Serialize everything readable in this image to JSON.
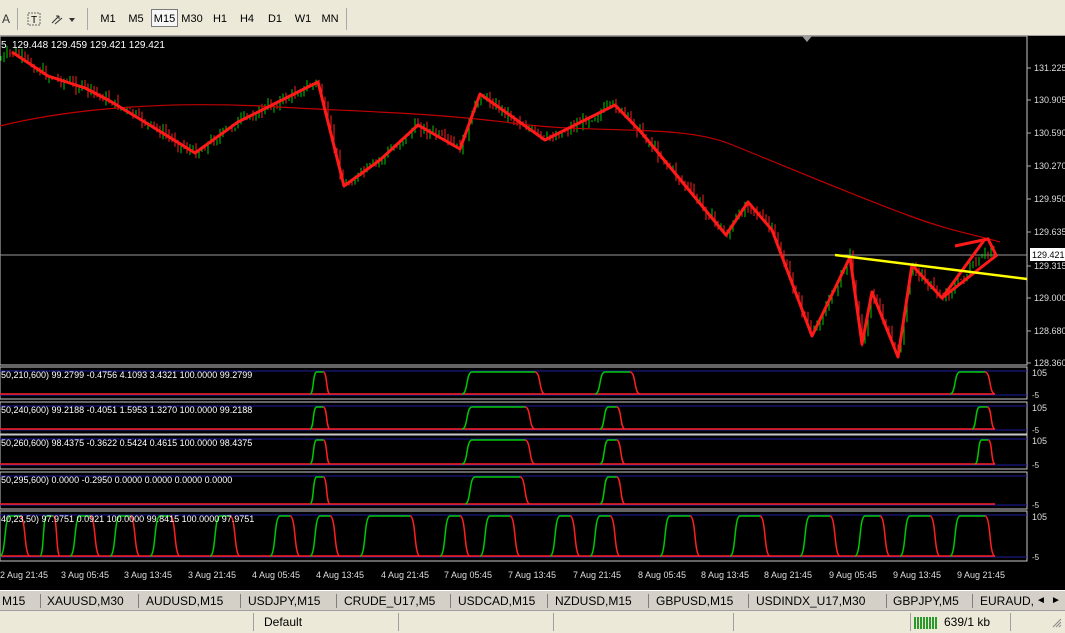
{
  "toolbar": {
    "left_label": "A",
    "timeframes": [
      "M1",
      "M5",
      "M15",
      "M30",
      "H1",
      "H4",
      "D1",
      "W1",
      "MN"
    ],
    "selected_timeframe": "M15"
  },
  "chart": {
    "ohlc_header": {
      "prefix": "5",
      "values": "129.448 129.459 129.421 129.421"
    },
    "price_labels": [
      "131.225",
      "130.905",
      "130.590",
      "130.270",
      "129.950",
      "129.635",
      "129.315",
      "129.000",
      "128.680",
      "128.360"
    ],
    "current_price": "129.421",
    "time_labels": [
      "2 Aug 21:45",
      "3 Aug 05:45",
      "3 Aug 13:45",
      "3 Aug 21:45",
      "4 Aug 05:45",
      "4 Aug 13:45",
      "4 Aug 21:45",
      "7 Aug 05:45",
      "7 Aug 13:45",
      "7 Aug 21:45",
      "8 Aug 05:45",
      "8 Aug 13:45",
      "8 Aug 21:45",
      "9 Aug 05:45",
      "9 Aug 13:45",
      "9 Aug 21:45"
    ],
    "indicators": [
      {
        "label": "50,210,600) 99.2799 -0.4756 4.1093 3.4321 100.0000 99.2799",
        "top": "105",
        "bottom": "-5"
      },
      {
        "label": "50,240,600) 99.2188 -0.4051 1.5953 1.3270 100.0000 99.2188",
        "top": "105",
        "bottom": "-5"
      },
      {
        "label": "50,260,600) 98.4375 -0.3622 0.5424 0.4615 100.0000 98.4375",
        "top": "105",
        "bottom": "-5"
      },
      {
        "label": "50,295,600) 0.0000 -0.2950 0.0000 0.0000 0.0000 0.0000",
        "top": "",
        "bottom": "-5"
      },
      {
        "label": "40,23,50) 97.9751 0.0921 100.0000 99.8415 100.0000 97.9751",
        "top": "105",
        "bottom": "-5"
      }
    ],
    "colors": {
      "up": "#00c800",
      "down": "#ff2020",
      "zigzag": "#ff1a1a",
      "ma": "#c00000",
      "trend": "#ffff00",
      "grid": "#1e1ea0"
    }
  },
  "tabs": [
    "M15",
    "XAUUSD,M30",
    "AUDUSD,M15",
    "USDJPY,M15",
    "CRUDE_U17,M5",
    "USDCAD,M15",
    "NZDUSD,M15",
    "GBPUSD,M15",
    "USDINDX_U17,M30",
    "GBPJPY,M5",
    "EURAUD,"
  ],
  "status": {
    "profile": "Default",
    "traffic": "639/1 kb"
  }
}
